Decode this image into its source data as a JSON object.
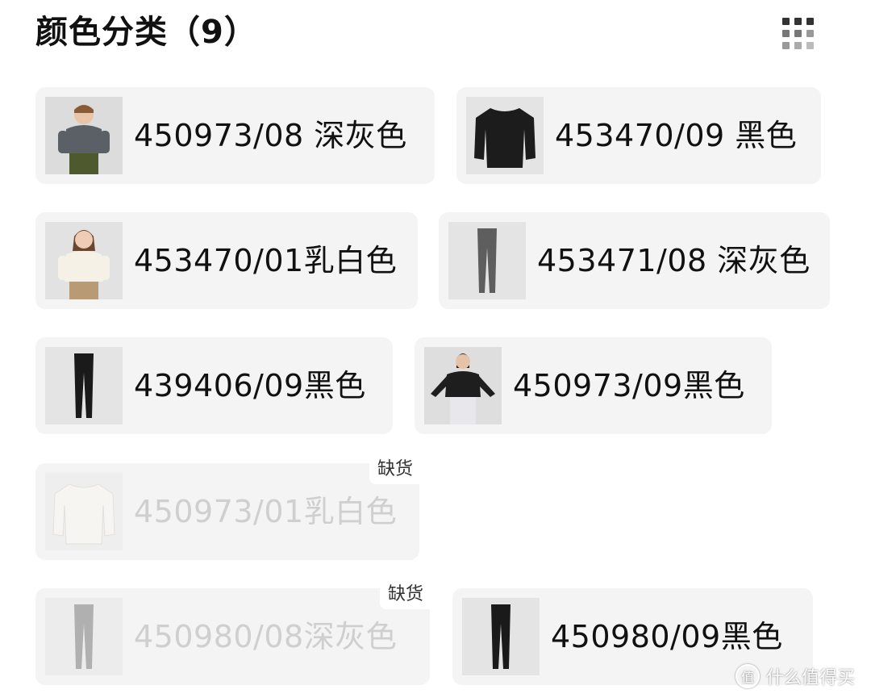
{
  "header": {
    "title": "颜色分类（9）",
    "view_toggle_icon": "grid-view-icon"
  },
  "variants": [
    {
      "label": "450973/08 深灰色",
      "thumbnail": "kid-model-dark-gray-sweater",
      "available": true
    },
    {
      "label": "453470/09 黑色",
      "thumbnail": "black-long-sleeve-top",
      "available": true
    },
    {
      "label": "453470/01乳白色",
      "thumbnail": "kid-model-cream-top",
      "available": true
    },
    {
      "label": "453471/08 深灰色",
      "thumbnail": "dark-gray-leggings",
      "available": true
    },
    {
      "label": "439406/09黑色",
      "thumbnail": "black-leggings",
      "available": true
    },
    {
      "label": "450973/09黑色",
      "thumbnail": "kid-model-black-sweater",
      "available": true
    },
    {
      "label": "450973/01乳白色",
      "thumbnail": "cream-long-sleeve-top",
      "available": false,
      "badge": "缺货"
    },
    {
      "label": "450980/08深灰色",
      "thumbnail": "dark-gray-leggings",
      "available": false,
      "badge": "缺货"
    },
    {
      "label": "450980/09黑色",
      "thumbnail": "black-leggings",
      "available": true
    }
  ],
  "colors": {
    "text_primary": "#111111",
    "text_disabled": "#cfcfcf",
    "card_background": "#f4f4f4"
  },
  "watermark": {
    "icon": "值",
    "text": "什么值得买"
  }
}
